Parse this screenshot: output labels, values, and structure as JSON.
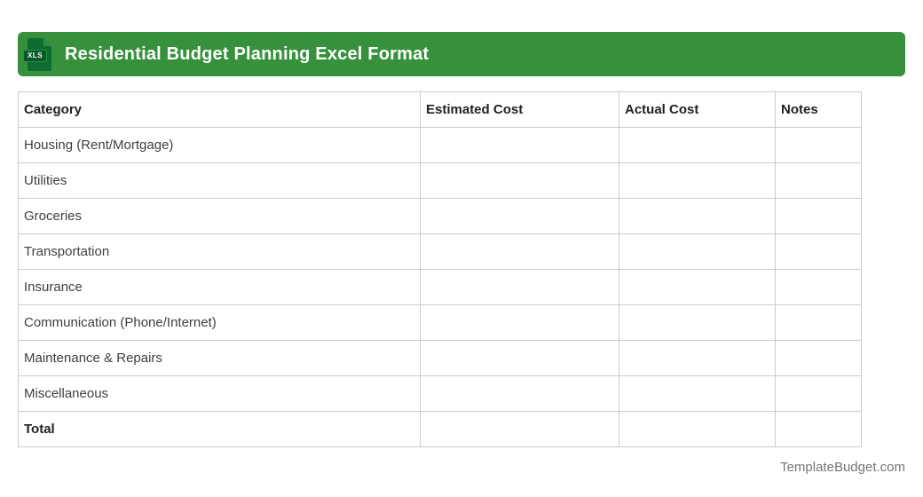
{
  "banner": {
    "title": "Residential Budget Planning Excel Format",
    "icon_label": "XLS"
  },
  "colors": {
    "banner_green": "#37913C",
    "icon_doc_green": "#0C6D31",
    "icon_fold_green": "#2F8C44",
    "icon_label_green": "#07592A",
    "border_gray": "#CCCCCC",
    "header_text": "#202124",
    "body_text": "#3C4043",
    "footer_text": "#757575"
  },
  "table": {
    "columns": [
      "Category",
      "Estimated Cost",
      "Actual Cost",
      "Notes"
    ],
    "rows": [
      {
        "category": "Housing (Rent/Mortgage)",
        "estimated_cost": "",
        "actual_cost": "",
        "notes": ""
      },
      {
        "category": "Utilities",
        "estimated_cost": "",
        "actual_cost": "",
        "notes": ""
      },
      {
        "category": "Groceries",
        "estimated_cost": "",
        "actual_cost": "",
        "notes": ""
      },
      {
        "category": "Transportation",
        "estimated_cost": "",
        "actual_cost": "",
        "notes": ""
      },
      {
        "category": "Insurance",
        "estimated_cost": "",
        "actual_cost": "",
        "notes": ""
      },
      {
        "category": "Communication (Phone/Internet)",
        "estimated_cost": "",
        "actual_cost": "",
        "notes": ""
      },
      {
        "category": "Maintenance & Repairs",
        "estimated_cost": "",
        "actual_cost": "",
        "notes": ""
      },
      {
        "category": "Miscellaneous",
        "estimated_cost": "",
        "actual_cost": "",
        "notes": ""
      },
      {
        "category": "Total",
        "estimated_cost": "",
        "actual_cost": "",
        "notes": ""
      }
    ]
  },
  "footer": {
    "site": "TemplateBudget.com"
  }
}
